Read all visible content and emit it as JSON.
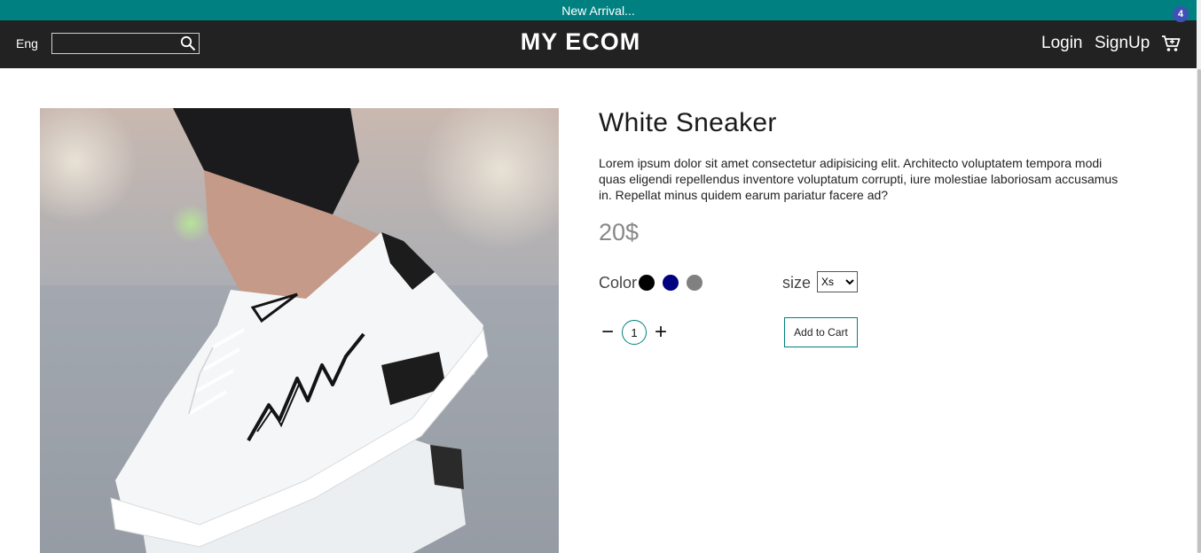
{
  "announcement": {
    "text": "New Arrival..."
  },
  "header": {
    "language": "Eng",
    "search": {
      "value": "",
      "placeholder": ""
    },
    "logo": "MY ECOM",
    "login_label": "Login",
    "signup_label": "SignUp",
    "cart_count": "4"
  },
  "product": {
    "title": "White Sneaker",
    "description": "Lorem ipsum dolor sit amet consectetur adipisicing elit. Architecto voluptatem tempora modi quas eligendi repellendus inventore voluptatum corrupti, iure molestiae laboriosam accusamus in. Repellat minus quidem earum pariatur facere ad?",
    "price": "20$",
    "color_label": "Color",
    "colors": [
      "#000000",
      "#000080",
      "#808080"
    ],
    "size_label": "size",
    "size_selected": "Xs",
    "quantity": "1",
    "decrement_label": "−",
    "increment_label": "+",
    "add_to_cart_label": "Add to Cart"
  },
  "theme": {
    "accent": "#008080",
    "nav_bg": "#222222",
    "badge": "#3f51b5"
  }
}
